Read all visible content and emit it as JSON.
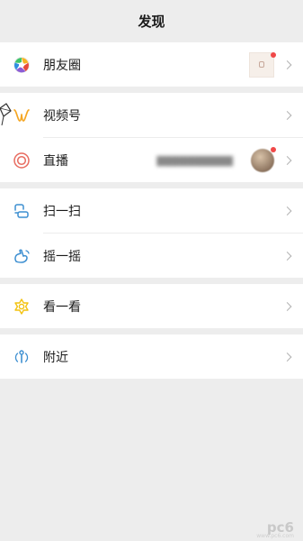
{
  "header": {
    "title": "发现"
  },
  "groups": [
    {
      "items": [
        {
          "label": "朋友圈",
          "icon": "moments-icon"
        }
      ]
    },
    {
      "items": [
        {
          "label": "视频号",
          "icon": "channels-icon"
        },
        {
          "label": "直播",
          "icon": "live-icon"
        }
      ]
    },
    {
      "items": [
        {
          "label": "扫一扫",
          "icon": "scan-icon"
        },
        {
          "label": "摇一摇",
          "icon": "shake-icon"
        }
      ]
    },
    {
      "items": [
        {
          "label": "看一看",
          "icon": "top-stories-icon"
        }
      ]
    },
    {
      "items": [
        {
          "label": "附近",
          "icon": "nearby-icon"
        }
      ]
    }
  ],
  "colors": {
    "background": "#ededed",
    "row": "#ffffff",
    "notification_dot": "#f04848",
    "channels": "#f5a623",
    "live": "#e86b5f",
    "scan": "#3d8fd1",
    "top_stories": "#f3c20f"
  },
  "watermark": {
    "text": "pc6",
    "url": "www.pc6.com"
  }
}
